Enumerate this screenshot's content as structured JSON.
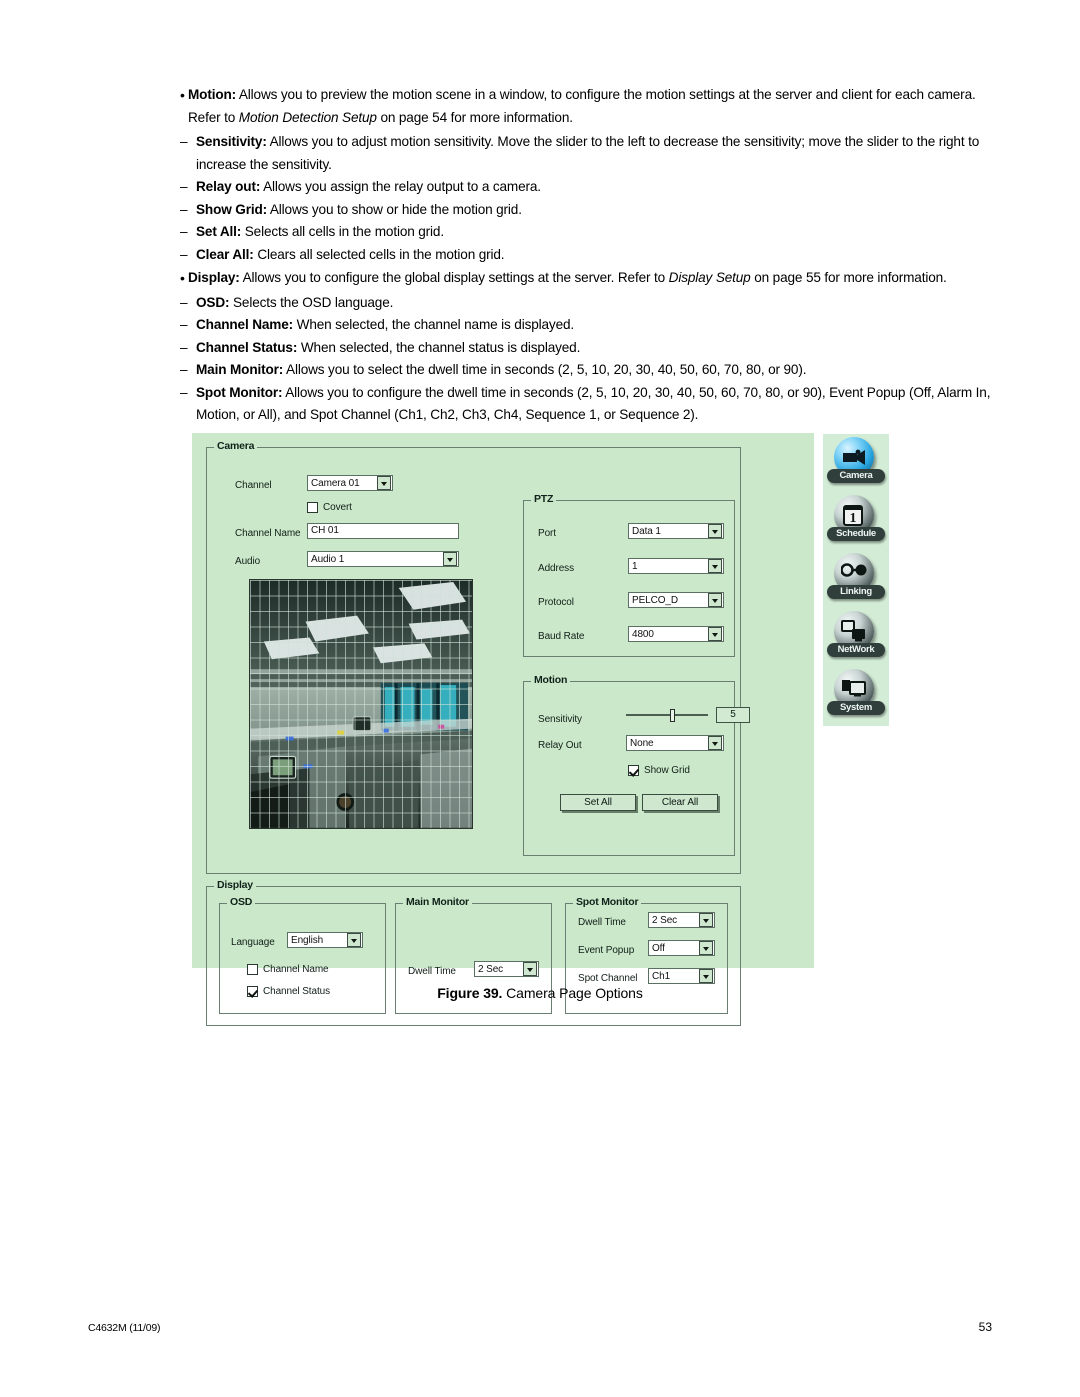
{
  "document": {
    "bullets": [
      {
        "term": "Motion:",
        "body": " Allows you to preview the motion scene in a window, to configure the motion settings at the server and client for each camera. Refer to ",
        "italic": "Motion Detection Setup",
        "tail": " on page 54 for more information.",
        "subs": [
          {
            "term": "Sensitivity:",
            "body": " Allows you to adjust motion sensitivity. Move the slider to the left to decrease the sensitivity; move the slider to the right to increase the sensitivity."
          },
          {
            "term": "Relay out:",
            "body": " Allows you assign the relay output to a camera."
          },
          {
            "term": "Show Grid:",
            "body": " Allows you to show or hide the motion grid."
          },
          {
            "term": "Set All:",
            "body": " Selects all cells in the motion grid."
          },
          {
            "term": "Clear All:",
            "body": " Clears all selected cells in the motion grid."
          }
        ]
      },
      {
        "term": "Display:",
        "body": " Allows you to configure the global display settings at the server. Refer to ",
        "italic": "Display Setup",
        "tail": " on page 55 for more information.",
        "subs": [
          {
            "term": "OSD:",
            "body": " Selects the OSD language."
          },
          {
            "term": "Channel Name:",
            "body": " When selected, the channel name is displayed."
          },
          {
            "term": "Channel Status:",
            "body": " When selected, the channel status is displayed."
          },
          {
            "term": "Main Monitor:",
            "body": " Allows you to select the dwell time in seconds (2, 5, 10, 20, 30, 40, 50, 60, 70, 80, or 90)."
          },
          {
            "term": "Spot Monitor:",
            "body": " Allows you to configure the dwell time in seconds (2, 5, 10, 20, 30, 40, 50, 60, 70, 80, or 90), Event Popup (Off, Alarm In, Motion, or All), and Spot Channel (Ch1, Ch2, Ch3, Ch4, Sequence 1, or Sequence 2)."
          }
        ]
      }
    ],
    "figure_caption_number": "Figure 39.",
    "figure_caption_text": " Camera Page Options",
    "footer_left": "C4632M (11/09)",
    "footer_page": "53"
  },
  "dialog": {
    "camera_group": {
      "title": "Camera",
      "channel_label": "Channel",
      "channel_value": "Camera 01",
      "covert_label": "Covert",
      "covert_checked": false,
      "channel_name_label": "Channel Name",
      "channel_name_value": "CH 01",
      "audio_label": "Audio",
      "audio_value": "Audio 1"
    },
    "ptz_group": {
      "title": "PTZ",
      "port_label": "Port",
      "port_value": "Data 1",
      "address_label": "Address",
      "address_value": "1",
      "protocol_label": "Protocol",
      "protocol_value": "PELCO_D",
      "baud_label": "Baud Rate",
      "baud_value": "4800"
    },
    "motion_group": {
      "title": "Motion",
      "sensitivity_label": "Sensitivity",
      "sensitivity_value": "5",
      "relay_label": "Relay Out",
      "relay_value": "None",
      "show_grid_label": "Show Grid",
      "show_grid_checked": true,
      "set_all_label": "Set All",
      "clear_all_label": "Clear All"
    },
    "display_group": {
      "title": "Display",
      "osd": {
        "title": "OSD",
        "language_label": "Language",
        "language_value": "English",
        "channel_name_label": "Channel Name",
        "channel_name_checked": false,
        "channel_status_label": "Channel Status",
        "channel_status_checked": true
      },
      "main_monitor": {
        "title": "Main Monitor",
        "dwell_label": "Dwell Time",
        "dwell_value": "2 Sec"
      },
      "spot_monitor": {
        "title": "Spot Monitor",
        "dwell_label": "Dwell Time",
        "dwell_value": "2 Sec",
        "event_popup_label": "Event Popup",
        "event_popup_value": "Off",
        "spot_channel_label": "Spot Channel",
        "spot_channel_value": "Ch1"
      }
    },
    "nav_icons": [
      {
        "label": "Camera",
        "icon": "camera-icon",
        "active": true
      },
      {
        "label": "Schedule",
        "icon": "calendar-icon",
        "active": false
      },
      {
        "label": "Linking",
        "icon": "glasses-icon",
        "active": false
      },
      {
        "label": "NetWork",
        "icon": "network-icon",
        "active": false
      },
      {
        "label": "System",
        "icon": "monitor-icon",
        "active": false
      }
    ]
  },
  "colors": {
    "dialog_bg": "#cbe8cb",
    "panel_border": "#6a7f72",
    "icon_strip_bg": "#d2ecd6",
    "active_icon": "#27a5e0"
  }
}
